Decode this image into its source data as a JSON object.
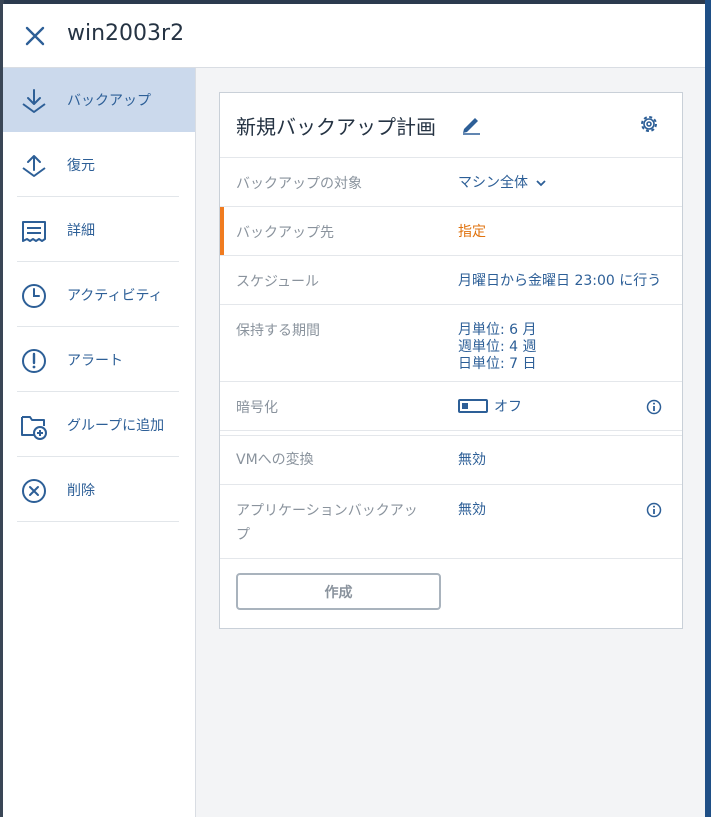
{
  "window": {
    "title": "win2003r2"
  },
  "sidebar": {
    "items": [
      {
        "label": "バックアップ",
        "icon": "download-icon",
        "active": true
      },
      {
        "label": "復元",
        "icon": "upload-icon",
        "active": false
      },
      {
        "label": "詳細",
        "icon": "details-icon",
        "active": false
      },
      {
        "label": "アクティビティ",
        "icon": "clock-icon",
        "active": false
      },
      {
        "label": "アラート",
        "icon": "alert-icon",
        "active": false
      },
      {
        "label": "グループに追加",
        "icon": "folder-add-icon",
        "active": false
      },
      {
        "label": "削除",
        "icon": "delete-circle-icon",
        "active": false
      }
    ]
  },
  "plan": {
    "title": "新規バックアップ計画",
    "rows": {
      "target": {
        "label": "バックアップの対象",
        "value": "マシン全体"
      },
      "destination": {
        "label": "バックアップ先",
        "value": "指定"
      },
      "schedule": {
        "label": "スケジュール",
        "value": "月曜日から金曜日 23:00 に行う"
      },
      "retention": {
        "label": "保持する期間",
        "lines": [
          "月単位: 6 月",
          "週単位: 4 週",
          "日単位: 7 日"
        ]
      },
      "encryption": {
        "label": "暗号化",
        "value": "オフ"
      },
      "vm_conversion": {
        "label": "VMへの変換",
        "value": "無効"
      },
      "app_backup": {
        "label_line1": "アプリケーションバックアッ",
        "label_line2": "プ",
        "value": "無効"
      }
    },
    "create_button": "作成"
  },
  "colors": {
    "accent_blue": "#2d5f97",
    "warning_orange": "#e0730f",
    "active_nav_bg": "#cbd9ec"
  }
}
